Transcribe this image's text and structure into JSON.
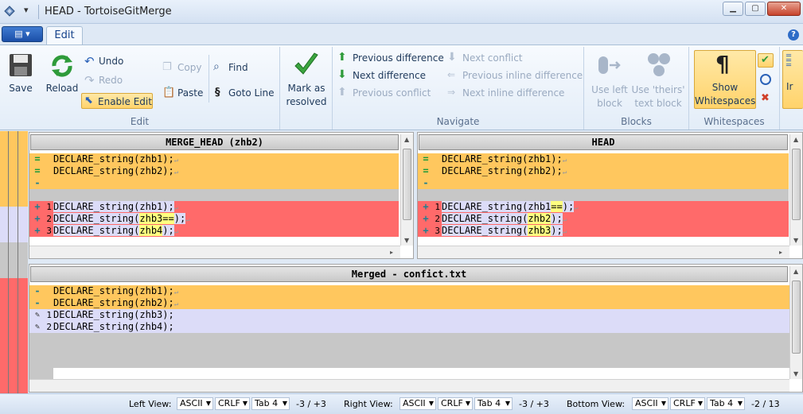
{
  "window": {
    "title": "HEAD - TortoiseGitMerge"
  },
  "ribbon": {
    "tab": "Edit",
    "groups": {
      "edit": "Edit",
      "navigate": "Navigate",
      "blocks": "Blocks",
      "whitespaces": "Whitespaces"
    },
    "save": "Save",
    "reload": "Reload",
    "undo": "Undo",
    "redo": "Redo",
    "enable_edit": "Enable Edit",
    "copy": "Copy",
    "paste": "Paste",
    "find": "Find",
    "goto_line": "Goto Line",
    "mark_resolved_1": "Mark as",
    "mark_resolved_2": "resolved",
    "prev_difference": "Previous difference",
    "next_difference": "Next difference",
    "prev_conflict": "Previous conflict",
    "next_conflict": "Next conflict",
    "prev_inline": "Previous inline difference",
    "next_inline": "Next inline difference",
    "use_left_1": "Use left",
    "use_left_2": "block",
    "use_theirs_1": "Use 'theirs'",
    "use_theirs_2": "text block",
    "show_ws_1": "Show",
    "show_ws_2": "Whitespaces",
    "partial_label": "Ir"
  },
  "left_pane": {
    "header": "MERGE_HEAD (zhb2)",
    "lines": [
      {
        "marker": "=",
        "num": "",
        "pre": "DECLARE_string(zhb1);",
        "hl": "",
        "post": ""
      },
      {
        "marker": "=",
        "num": "",
        "pre": "DECLARE_string(zhb2);",
        "hl": "",
        "post": ""
      },
      {
        "marker": "-",
        "num": "",
        "pre": "",
        "hl": "",
        "post": ""
      },
      {
        "marker": "+",
        "num": "1",
        "pre": "DECLARE_string(zhb1",
        "hl": "",
        "post": ");"
      },
      {
        "marker": "+",
        "num": "2",
        "pre": "DECLARE_string(",
        "hl": "zhb3==",
        "post": ");"
      },
      {
        "marker": "+",
        "num": "3",
        "pre": "DECLARE_string(",
        "hl": "zhb4",
        "post": ");"
      }
    ]
  },
  "right_pane": {
    "header": "HEAD",
    "lines": [
      {
        "marker": "=",
        "num": "",
        "pre": "DECLARE_string(zhb1);",
        "hl": "",
        "post": ""
      },
      {
        "marker": "=",
        "num": "",
        "pre": "DECLARE_string(zhb2);",
        "hl": "",
        "post": ""
      },
      {
        "marker": "-",
        "num": "",
        "pre": "",
        "hl": "",
        "post": ""
      },
      {
        "marker": "+",
        "num": "1",
        "pre": "DECLARE_string(zhb1",
        "hl": "==",
        "post": ");"
      },
      {
        "marker": "+",
        "num": "2",
        "pre": "DECLARE_string(",
        "hl": "zhb2",
        "post": ");"
      },
      {
        "marker": "+",
        "num": "3",
        "pre": "DECLARE_string(",
        "hl": "zhb3",
        "post": ");"
      }
    ]
  },
  "merged_pane": {
    "header": "Merged - confict.txt",
    "lines": [
      {
        "marker": "-",
        "num": "",
        "text": "DECLARE_string(zhb1);"
      },
      {
        "marker": "-",
        "num": "",
        "text": "DECLARE_string(zhb2);"
      },
      {
        "marker": "✎",
        "num": "1",
        "text": "DECLARE_string(zhb3);"
      },
      {
        "marker": "✎",
        "num": "2",
        "text": "DECLARE_string(zhb4);"
      }
    ]
  },
  "status": {
    "left_view_label": "Left View:",
    "left_encoding": "ASCII",
    "left_eol": "CRLF",
    "left_tab": "Tab 4",
    "left_count": "-3 / +3",
    "right_view_label": "Right View:",
    "right_encoding": "ASCII",
    "right_eol": "CRLF",
    "right_tab": "Tab 4",
    "right_count": "-3 / +3",
    "bottom_view_label": "Bottom View:",
    "bottom_encoding": "ASCII",
    "bottom_eol": "CRLF",
    "bottom_tab": "Tab 4",
    "bottom_count": "-2 / 13"
  },
  "colors": {
    "same": "#ffc75e",
    "conflict": "#ff6a6a",
    "edited": "#dcdcf8",
    "inline_highlight": "#ffff80"
  }
}
